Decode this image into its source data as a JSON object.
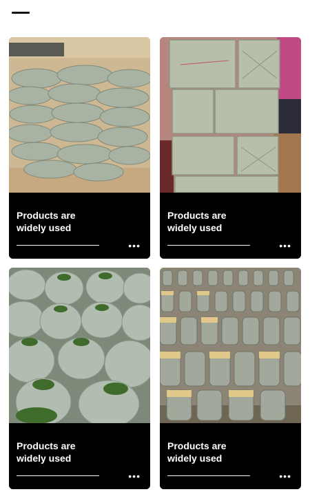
{
  "header": {
    "menu_icon": "minus-icon"
  },
  "cards": [
    {
      "title": "Products are\nwidely used",
      "more_icon": "ellipsis-icon",
      "more": "•••",
      "image": "stacked-sandbags-photo"
    },
    {
      "title": "Products are\nwidely used",
      "more_icon": "ellipsis-icon",
      "more": "•••",
      "image": "packed-bales-photo"
    },
    {
      "title": "Products are\nwidely used",
      "more_icon": "ellipsis-icon",
      "more": "•••",
      "image": "grass-sacks-photo"
    },
    {
      "title": "Products are\nwidely used",
      "more_icon": "ellipsis-icon",
      "more": "•••",
      "image": "sand-bags-rows-photo"
    }
  ],
  "colors": {
    "card_bg": "#000000",
    "text": "#ffffff",
    "bag": "#a8b3a2",
    "ground": "#c7b290"
  }
}
